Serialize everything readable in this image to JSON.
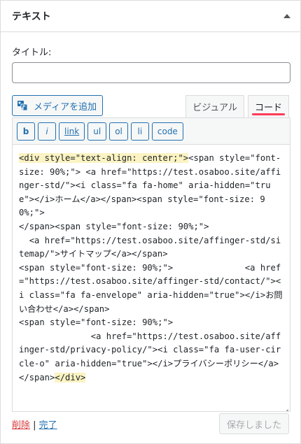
{
  "widget": {
    "title": "テキスト"
  },
  "form": {
    "title_label": "タイトル:",
    "title_value": ""
  },
  "toolbar": {
    "media_button": "メディアを追加"
  },
  "tabs": [
    {
      "label": "ビジュアル",
      "active": false
    },
    {
      "label": "コード",
      "active": true
    }
  ],
  "quicktags": [
    "b",
    "i",
    "link",
    "ul",
    "ol",
    "li",
    "code"
  ],
  "code": {
    "hl_start": "<div style=\"text-align: center;\">",
    "body": "<span style=\"font-size: 90%;\"> <a href=\"https://test.osaboo.site/affinger-std/\"><i class=\"fa fa-home\" aria-hidden=\"true\"></i>ホーム</a></span><span style=\"font-size: 90%;\">\n</span><span style=\"font-size: 90%;\">\n  <a href=\"https://test.osaboo.site/affinger-std/sitemap/\">サイトマップ</a></span>\n<span style=\"font-size: 90%;\">              <a href=\"https://test.osaboo.site/affinger-std/contact/\"><i class=\"fa fa-envelope\" aria-hidden=\"true\"></i>お問い合わせ</a></span>\n<span style=\"font-size: 90%;\">\n              <a href=\"https://test.osaboo.site/affinger-std/privacy-policy/\"><i class=\"fa fa-user-circle-o\" aria-hidden=\"true\"></i>プライバシーポリシー</a></span>",
    "hl_end": "</div>"
  },
  "footer": {
    "delete_label": "削除",
    "separator": " | ",
    "done_label": "完了",
    "save_label": "保存しました"
  },
  "colors": {
    "accent": "#2271b1",
    "active_underline": "#ff3b58",
    "delete": "#d63638",
    "highlight": "#fbf3c2"
  }
}
